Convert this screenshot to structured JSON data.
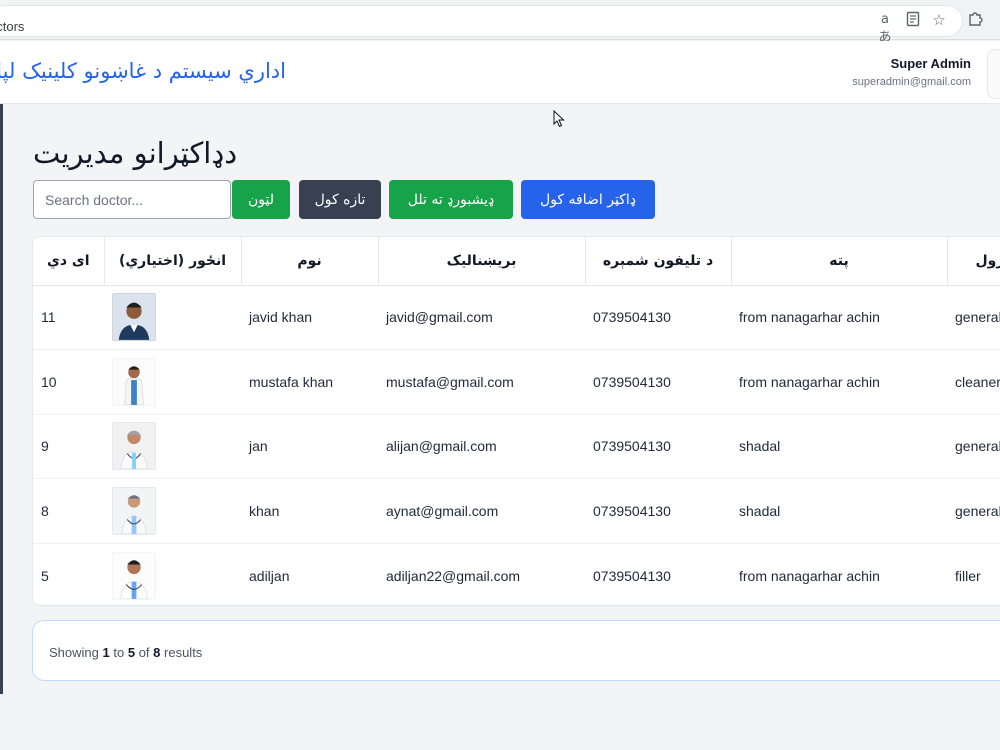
{
  "browser": {
    "url_text": "octors",
    "icons": [
      "translate-icon",
      "reader-icon",
      "star-icon",
      "extensions-icon"
    ]
  },
  "header": {
    "app_title": "اداري سیستم د غاښونو کلینیک لپاره",
    "user_name": "Super Admin",
    "user_email": "superadmin@gmail.com"
  },
  "page": {
    "title": "دډاکټرانو مدیریت",
    "search_placeholder": "Search doctor...",
    "buttons": {
      "search": "لټون",
      "refresh": "تازه کول",
      "dashboard": "ډیشبورډ ته تلل",
      "add_doctor": "ډاکټر اضافه کول"
    }
  },
  "table": {
    "headers": {
      "id": "ای دي",
      "photo": "انځور (اختیاري)",
      "name": "نوم",
      "email": "بریښنالیک",
      "phone": "د تلیفون شمېره",
      "address": "پته",
      "role": "رول"
    },
    "rows": [
      {
        "id": "11",
        "photo": "doctor-photo-1",
        "name": "javid khan",
        "email": "javid@gmail.com",
        "phone": "0739504130",
        "address": "from nanagarhar achin",
        "role": "general"
      },
      {
        "id": "10",
        "photo": "doctor-photo-2",
        "name": "mustafa khan",
        "email": "mustafa@gmail.com",
        "phone": "0739504130",
        "address": "from nanagarhar achin",
        "role": "cleaner"
      },
      {
        "id": "9",
        "photo": "doctor-photo-3",
        "name": "jan",
        "email": "alijan@gmail.com",
        "phone": "0739504130",
        "address": "shadal",
        "role": "general"
      },
      {
        "id": "8",
        "photo": "doctor-photo-4",
        "name": "khan",
        "email": "aynat@gmail.com",
        "phone": "0739504130",
        "address": "shadal",
        "role": "general"
      },
      {
        "id": "5",
        "photo": "doctor-photo-5",
        "name": "adiljan",
        "email": "adiljan22@gmail.com",
        "phone": "0739504130",
        "address": "from nanagarhar achin",
        "role": "filler"
      }
    ]
  },
  "pagination": {
    "prefix": "Showing",
    "from": "1",
    "to_word": "to",
    "to": "5",
    "of_word": "of",
    "total": "8",
    "suffix": "results"
  },
  "colors": {
    "primary": "#2563eb",
    "success": "#16a34a",
    "dark": "#374151"
  }
}
